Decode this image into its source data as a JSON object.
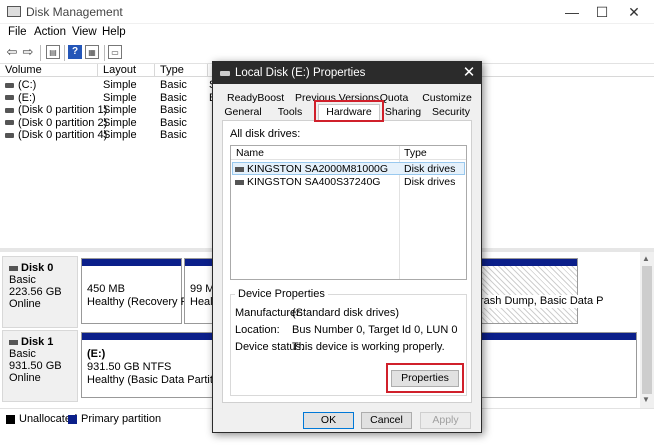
{
  "window": {
    "title": "Disk Management",
    "minimize": "—",
    "maximize": "☐",
    "close": "✕"
  },
  "menu": [
    "File",
    "Action",
    "View",
    "Help"
  ],
  "volume_list": {
    "columns": [
      "Volume",
      "Layout",
      "Type"
    ],
    "rows": [
      {
        "volume": "(C:)",
        "layout": "Simple",
        "type": "Basic"
      },
      {
        "volume": "(E:)",
        "layout": "Simple",
        "type": "Basic"
      },
      {
        "volume": "(Disk 0 partition 1)",
        "layout": "Simple",
        "type": "Basic"
      },
      {
        "volume": "(Disk 0 partition 2)",
        "layout": "Simple",
        "type": "Basic"
      },
      {
        "volume": "(Disk 0 partition 4)",
        "layout": "Simple",
        "type": "Basic"
      }
    ],
    "partial_col_chars": [
      "S",
      "B",
      "B"
    ]
  },
  "disks": [
    {
      "name": "Disk 0",
      "type": "Basic",
      "size": "223.56 GB",
      "status": "Online",
      "partitions": [
        {
          "line1": "450 MB",
          "line2": "Healthy (Recovery Part"
        },
        {
          "line1": "99 MB",
          "line2": "Health"
        },
        {
          "line1": "",
          "line2": "rash Dump, Basic Data P"
        }
      ]
    },
    {
      "name": "Disk 1",
      "type": "Basic",
      "size": "931.50 GB",
      "status": "Online",
      "partitions": [
        {
          "line0": "(E:)",
          "line1": "931.50 GB NTFS",
          "line2": "Healthy (Basic Data Partition)"
        }
      ]
    }
  ],
  "legend": {
    "unallocated": "Unallocated",
    "primary": "Primary partition",
    "unallocated_color": "#000000",
    "primary_color": "#0b1f8a"
  },
  "dialog": {
    "title": "Local Disk (E:) Properties",
    "close": "✕",
    "tabs_row1": [
      "ReadyBoost",
      "Previous Versions",
      "Quota",
      "Customize"
    ],
    "tabs_row2": [
      "General",
      "Tools",
      "Hardware",
      "Sharing",
      "Security"
    ],
    "active_tab": "Hardware",
    "all_drives_label": "All disk drives:",
    "drive_columns": [
      "Name",
      "Type"
    ],
    "drives": [
      {
        "name": "KINGSTON SA2000M81000G",
        "type": "Disk drives"
      },
      {
        "name": "KINGSTON SA400S37240G",
        "type": "Disk drives"
      }
    ],
    "device_properties": {
      "heading": "Device Properties",
      "manufacturer_label": "Manufacturer:",
      "manufacturer": "(Standard disk drives)",
      "location_label": "Location:",
      "location": "Bus Number 0, Target Id 0, LUN 0",
      "status_label": "Device status:",
      "status": "This device is working properly.",
      "properties_button": "Properties"
    },
    "buttons": {
      "ok": "OK",
      "cancel": "Cancel",
      "apply": "Apply"
    },
    "highlight_color": "#d0202b"
  }
}
